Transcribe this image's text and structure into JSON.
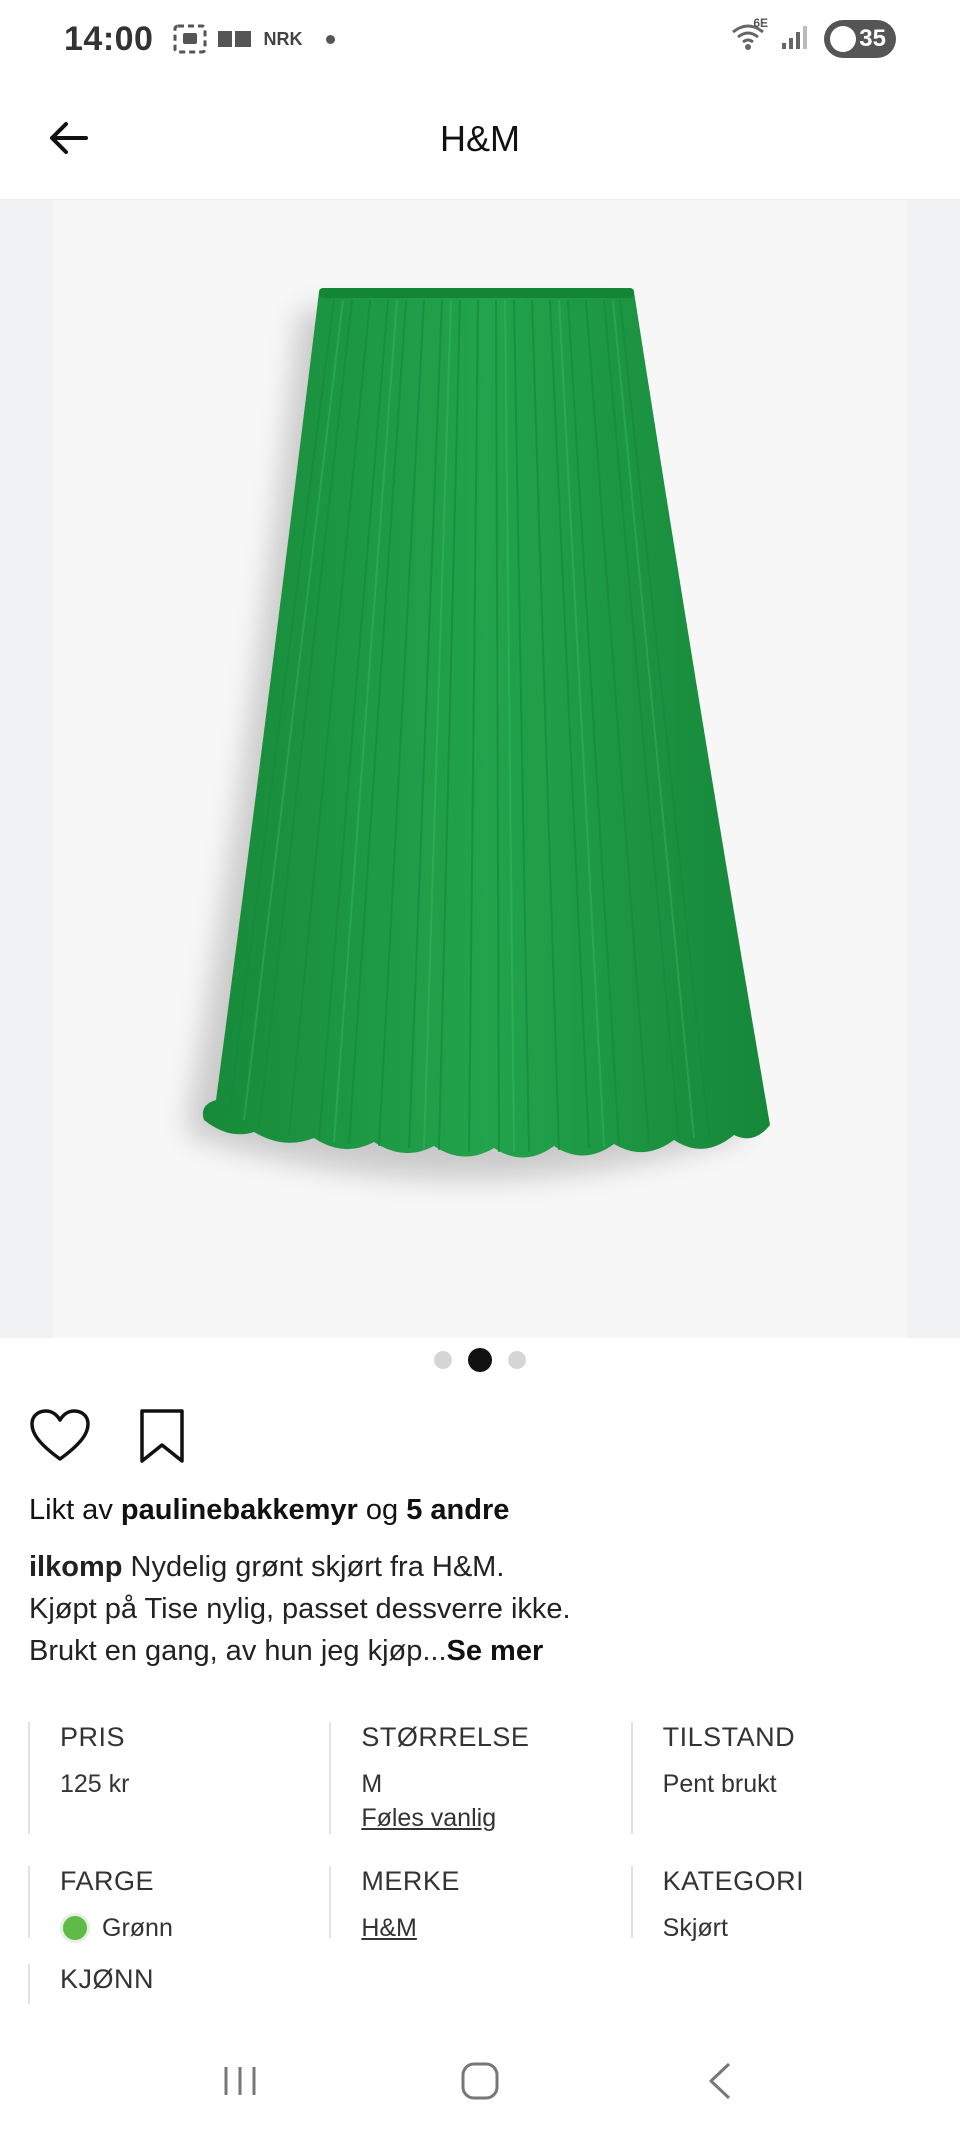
{
  "status_bar": {
    "time": "14:00",
    "notif_text": "NRK",
    "network_label": "6E",
    "battery": "35"
  },
  "app_bar": {
    "title": "H&M"
  },
  "product_image": {
    "alt": "Green pleated skirt",
    "skirt_color": "#1f9a45",
    "page_count": 3,
    "active_page": 2
  },
  "actions": {
    "like_icon": "heart-icon",
    "save_icon": "bookmark-icon"
  },
  "likes": {
    "prefix": "Likt av",
    "user": "paulinebakkemyr",
    "joiner": "og",
    "others": "5 andre"
  },
  "caption": {
    "author": "ilkomp",
    "line1": "Nydelig grønt skjørt fra H&M.",
    "line2": "Kjøpt på Tise nylig, passet dessverre ikke.",
    "line3": "Brukt en gang, av hun jeg kjøp...",
    "see_more": "Se mer"
  },
  "details": {
    "pris": {
      "label": "PRIS",
      "value": "125 kr"
    },
    "storrelse": {
      "label": "STØRRELSE",
      "value": "M",
      "link": "Føles vanlig"
    },
    "tilstand": {
      "label": "TILSTAND",
      "value": "Pent brukt"
    },
    "farge": {
      "label": "FARGE",
      "value": "Grønn",
      "swatch": "#5dbb46"
    },
    "merke": {
      "label": "MERKE",
      "value": "H&M"
    },
    "kategori": {
      "label": "KATEGORI",
      "value": "Skjørt"
    },
    "kjonn": {
      "label": "KJØNN"
    }
  },
  "nav_bar": {
    "recents_icon": "recents-icon",
    "home_icon": "home-icon",
    "back_icon": "back-icon"
  }
}
